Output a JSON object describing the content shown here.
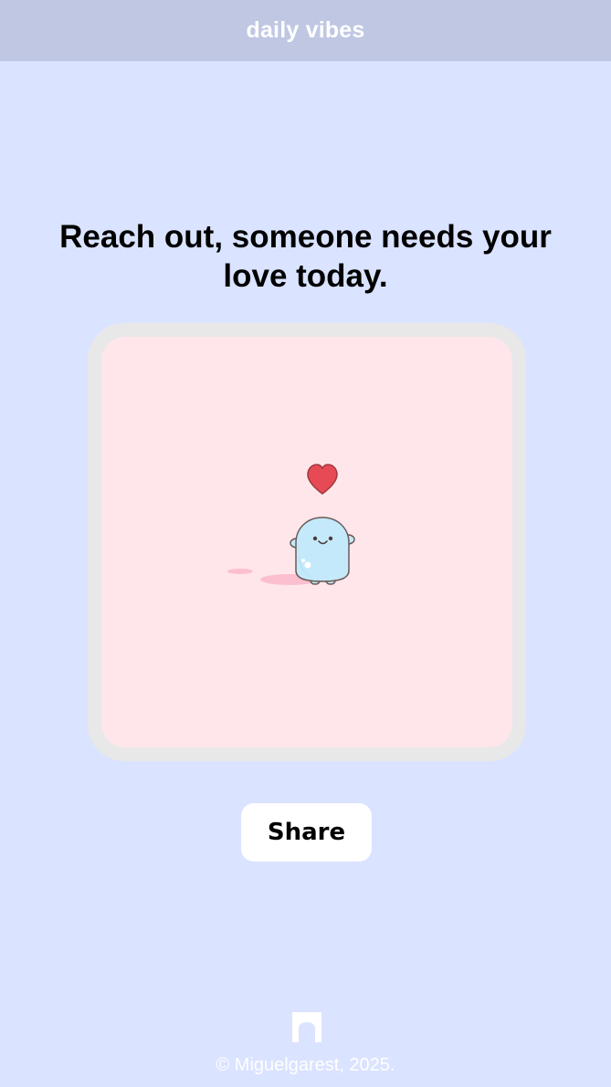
{
  "header": {
    "title": "daily vibes"
  },
  "main": {
    "quote": "Reach out, someone needs your love today.",
    "illustration": {
      "icon": "heart-mascot-icon",
      "background_color": "#ffe6eb",
      "frame_color": "#e8e8e8"
    },
    "share_label": "Share"
  },
  "footer": {
    "logo_icon": "arch-logo-icon",
    "copyright": "© Miguelgarest, 2025."
  },
  "colors": {
    "page_background": "#dae3ff",
    "header_background": "#bfc7e3",
    "heart": "#e84a55",
    "mascot": "#c4e9fb"
  }
}
